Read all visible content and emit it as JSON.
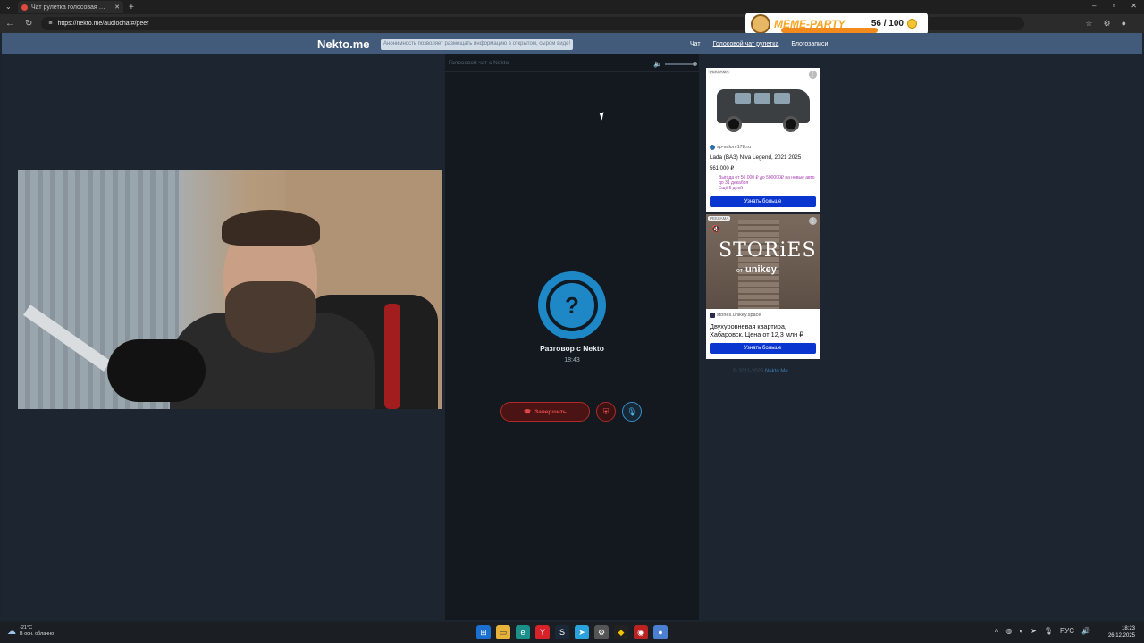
{
  "browser": {
    "tab_title": "Чат рулетка голосовая — N",
    "url": "https://nekto.me/audiochat#/peer"
  },
  "overlay": {
    "logo_text": "MEME-PARTY",
    "counter": "56 / 100"
  },
  "site": {
    "brand": "Nekto.me",
    "banner": "Анонимность позволяет размещать информацию в открытом, сыром виде!",
    "nav": [
      "Чат",
      "Голосовой чат рулетка",
      "Блогозаписи"
    ]
  },
  "chat": {
    "header": "Голосовой чат с Nekto",
    "avatar_glyph": "?",
    "title": "Разговор с Nekto",
    "time": "18:43",
    "end_button": "Завершить"
  },
  "ads": [
    {
      "tag": "РЕКЛАМА",
      "source": "sp-salon-178.ru",
      "title": "Lada (ВАЗ) Niva Legend, 2021 2025",
      "price": "561 000 ₽",
      "promo": "Выгода от 50 000 ₽ до 500000₽ на новые авто до 31 декабря",
      "promo_days": "Ещё 5 дней",
      "cta": "Узнать больше"
    },
    {
      "tag": "РЕКЛАМА",
      "image_word": "STORiES",
      "image_sub_prefix": "от",
      "image_sub_brand": "unikey",
      "source": "stories.unikey.space",
      "title": "Двухуровневая квартира, Хабаровск. Цена от 12,3 млн ₽",
      "cta": "Узнать больше"
    }
  ],
  "below_ads": {
    "copyright": "© 2011-2025",
    "link": "Nekto.Me"
  },
  "taskbar": {
    "temp": "-21°C",
    "weather": "В осн. облачно",
    "lang": "РУС",
    "time": "18:23",
    "date": "26.12.2025"
  },
  "colors": {
    "accent": "#1e88c7",
    "danger": "#e84a4a",
    "header_bg": "#435b7a",
    "ad_cta": "#0a36cf"
  }
}
